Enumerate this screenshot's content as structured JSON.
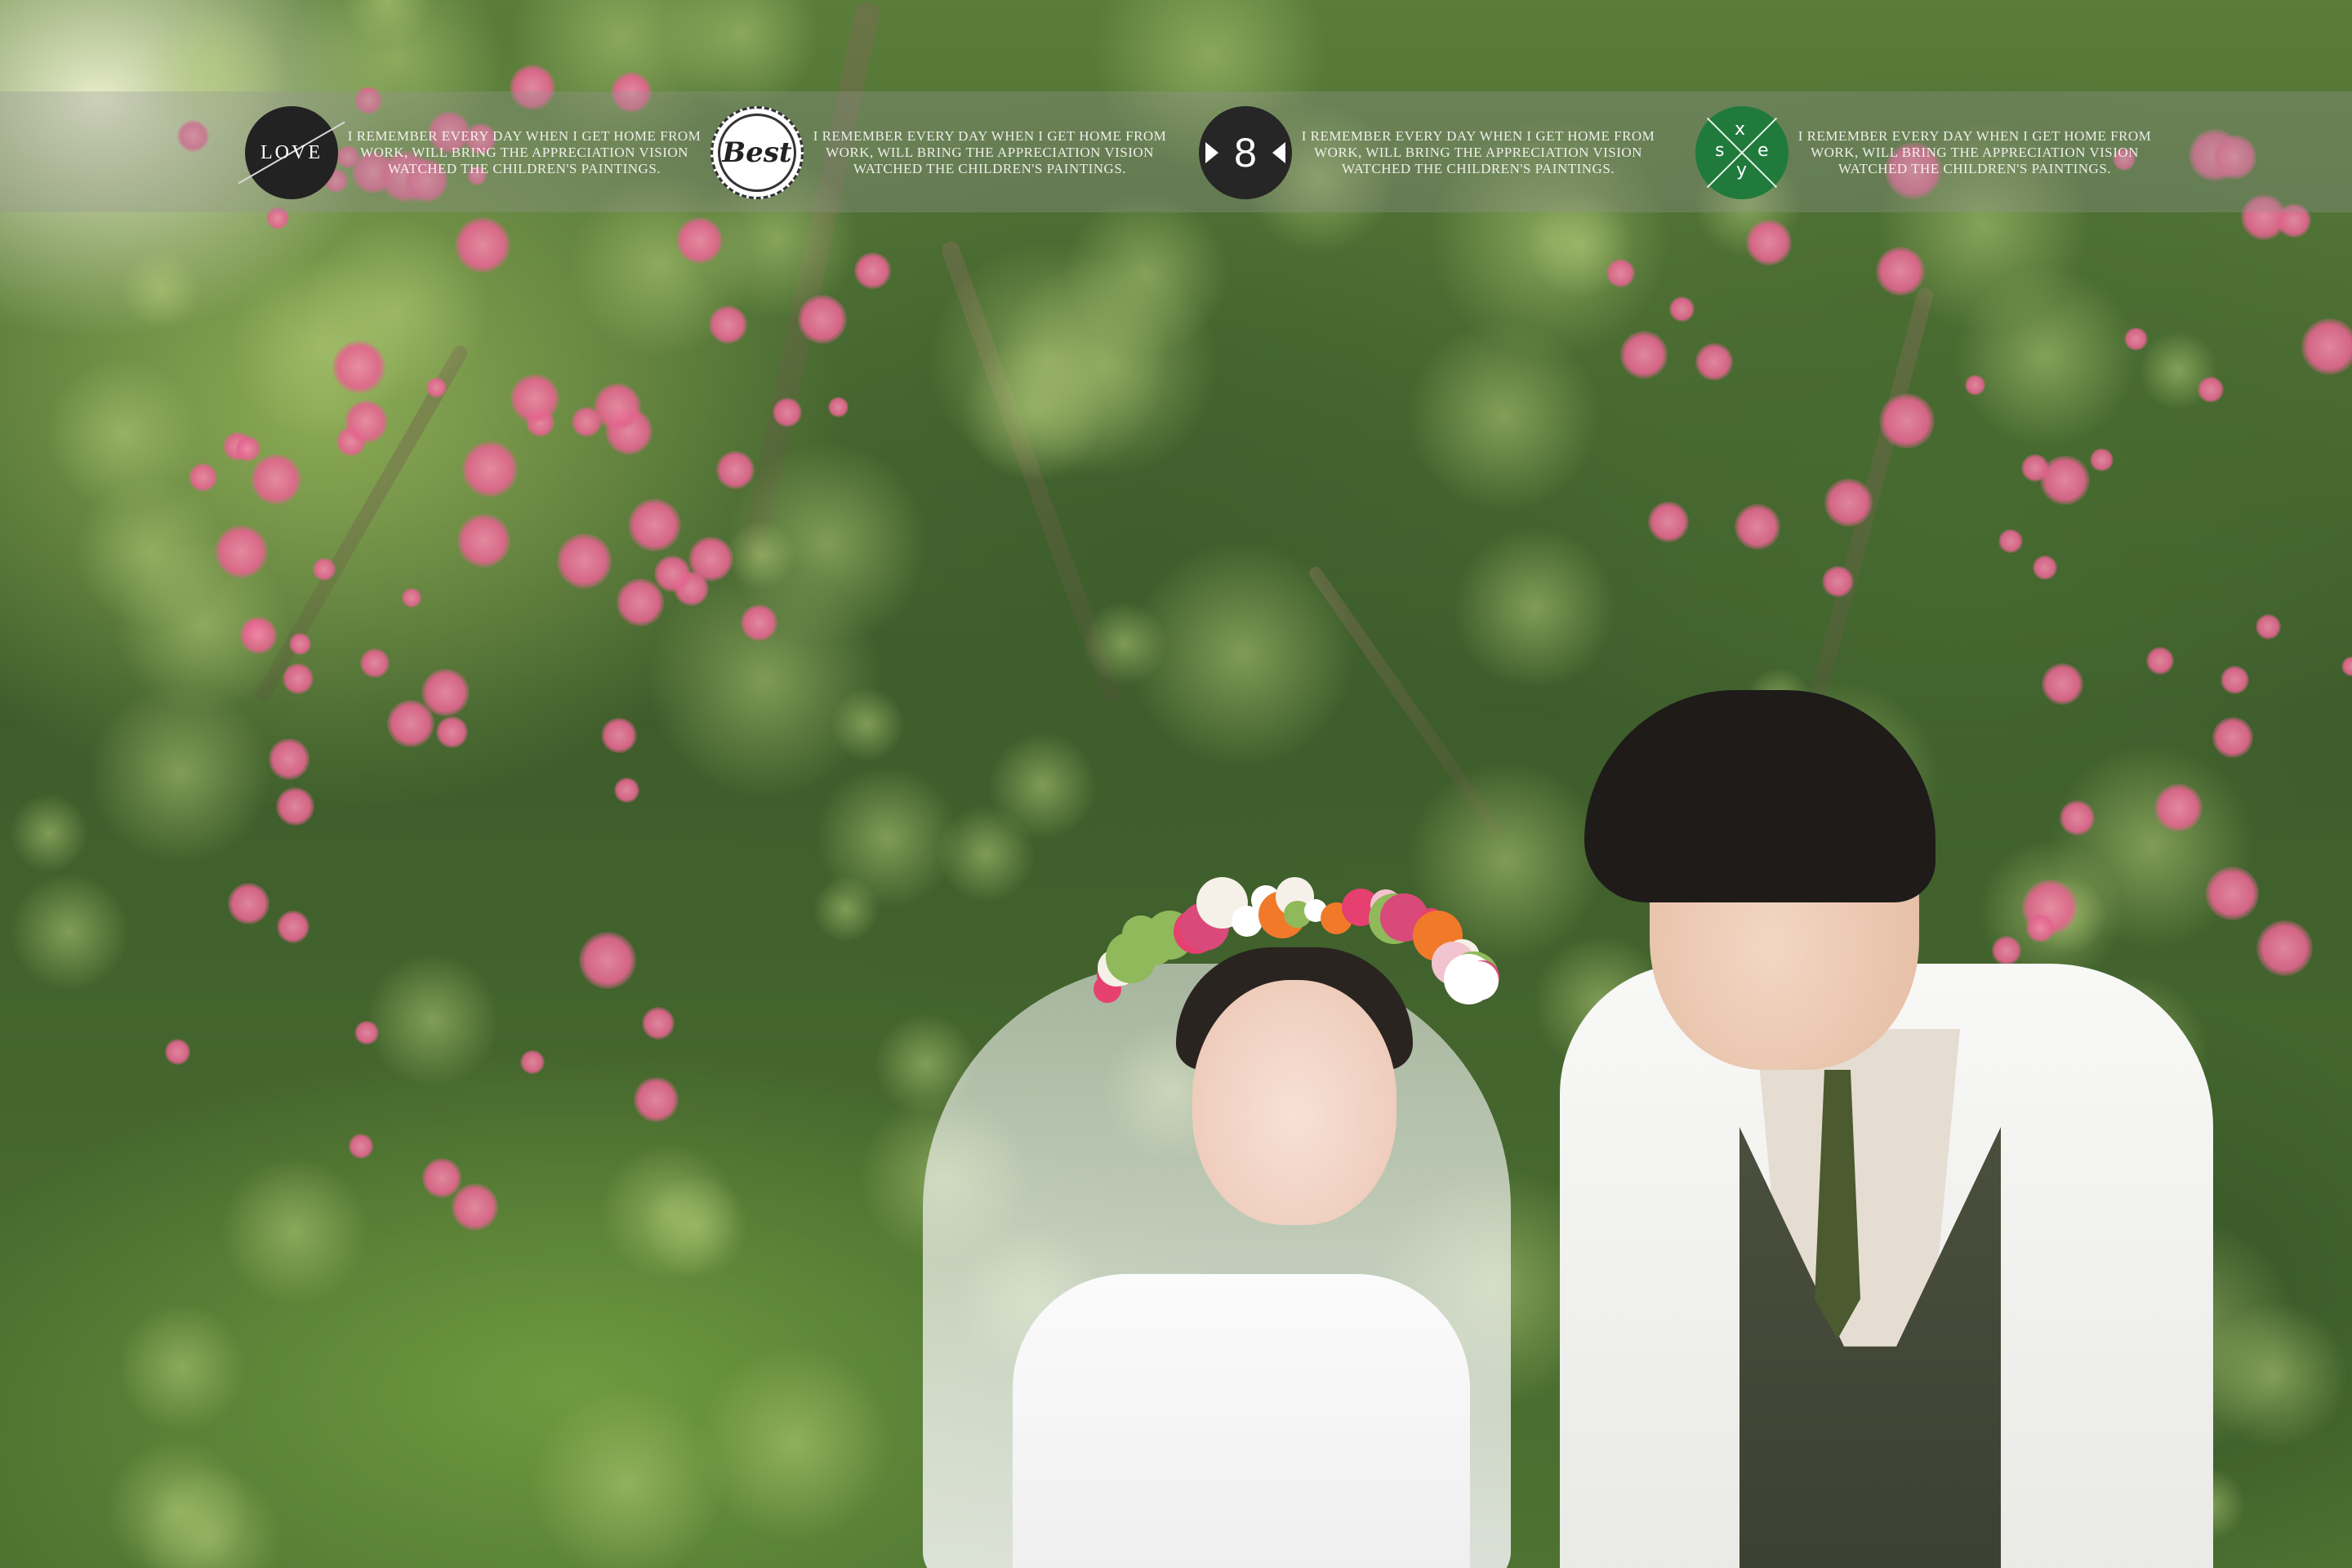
{
  "badges": [
    {
      "icon": "love-arrow-icon",
      "label": "LOVE",
      "color": "#222222",
      "caption": "I REMEMBER EVERY DAY WHEN I GET HOME FROM WORK, WILL BRING THE APPRECIATION VISION WATCHED THE CHILDREN'S PAINTINGS."
    },
    {
      "icon": "best-stamp-icon",
      "label": "Best",
      "color": "#ffffff",
      "caption": "I REMEMBER EVERY DAY WHEN I GET HOME FROM WORK, WILL BRING THE APPRECIATION VISION WATCHED THE CHILDREN'S PAINTINGS."
    },
    {
      "icon": "number-eight-icon",
      "label": "8",
      "color": "#262626",
      "caption": "I REMEMBER EVERY DAY WHEN I GET HOME FROM WORK, WILL BRING THE APPRECIATION VISION WATCHED THE CHILDREN'S PAINTINGS."
    },
    {
      "icon": "sexy-cross-icon",
      "label": "sexy",
      "letters": [
        "s",
        "e",
        "x",
        "y"
      ],
      "color": "#1f7a3c",
      "caption": "I REMEMBER EVERY DAY WHEN I GET HOME FROM WORK, WILL BRING THE APPRECIATION VISION WATCHED THE CHILDREN'S PAINTINGS."
    }
  ],
  "strip_color": "rgba(150,150,150,0.32)"
}
